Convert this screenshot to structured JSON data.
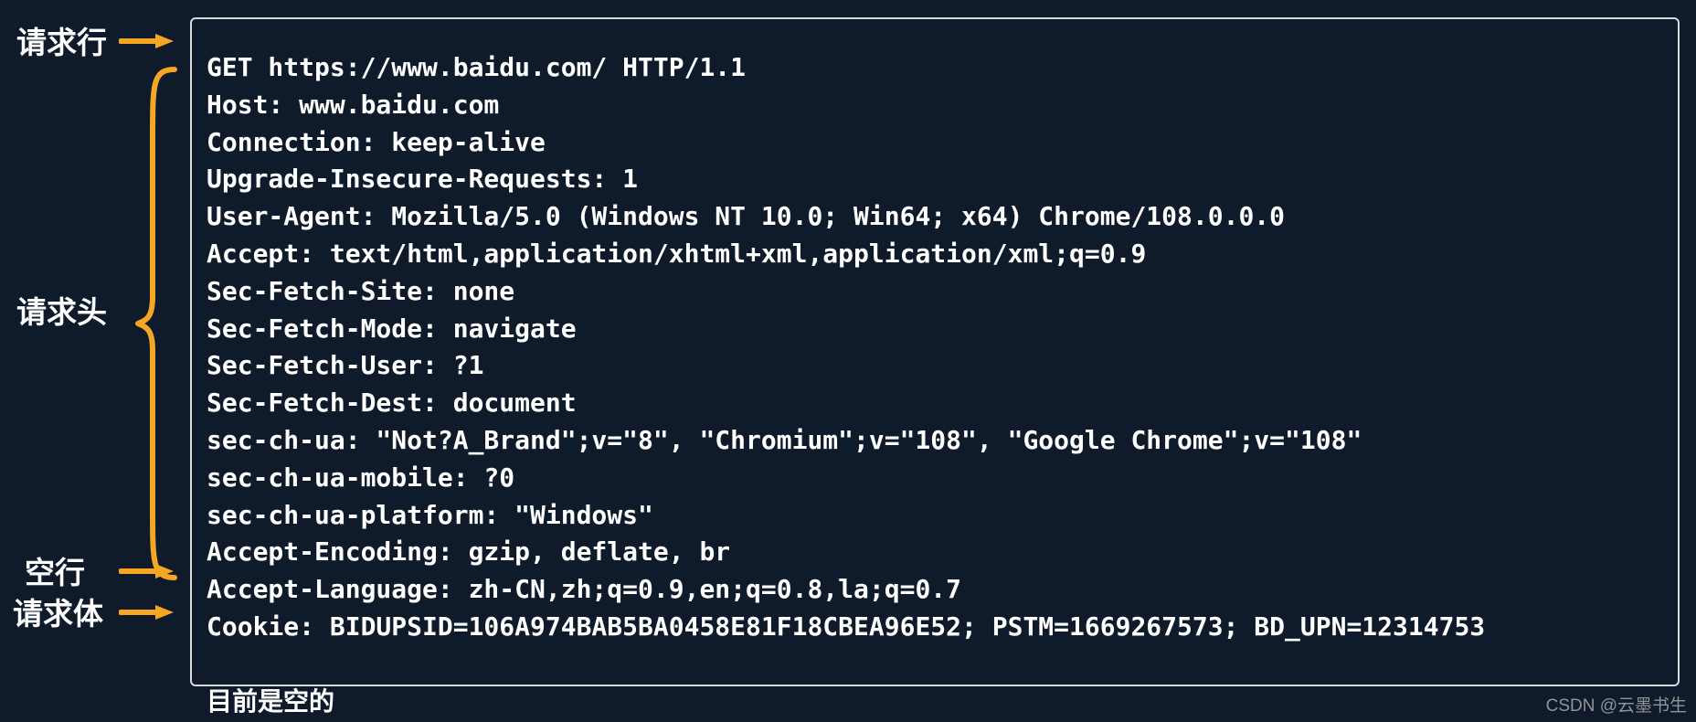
{
  "labels": {
    "request_line": "请求行",
    "request_headers": "请求头",
    "blank_line": "空行",
    "request_body": "请求体"
  },
  "http": {
    "request_line": "GET https://www.baidu.com/ HTTP/1.1",
    "headers": [
      "Host: www.baidu.com",
      "Connection: keep-alive",
      "Upgrade-Insecure-Requests: 1",
      "User-Agent: Mozilla/5.0 (Windows NT 10.0; Win64; x64) Chrome/108.0.0.0",
      "Accept: text/html,application/xhtml+xml,application/xml;q=0.9",
      "Sec-Fetch-Site: none",
      "Sec-Fetch-Mode: navigate",
      "Sec-Fetch-User: ?1",
      "Sec-Fetch-Dest: document",
      "sec-ch-ua: \"Not?A_Brand\";v=\"8\", \"Chromium\";v=\"108\", \"Google Chrome\";v=\"108\"",
      "sec-ch-ua-mobile: ?0",
      "sec-ch-ua-platform: \"Windows\"",
      "Accept-Encoding: gzip, deflate, br",
      "Accept-Language: zh-CN,zh;q=0.9,en;q=0.8,la;q=0.7",
      "Cookie: BIDUPSID=106A974BAB5BA0458E81F18CBEA96E52; PSTM=1669267573; BD_UPN=12314753"
    ],
    "body_note": "目前是空的"
  },
  "colors": {
    "accent": "#f5a623",
    "border": "#d9d9d9",
    "bg": "#0f1b2b"
  },
  "watermark": "CSDN @云墨书生"
}
